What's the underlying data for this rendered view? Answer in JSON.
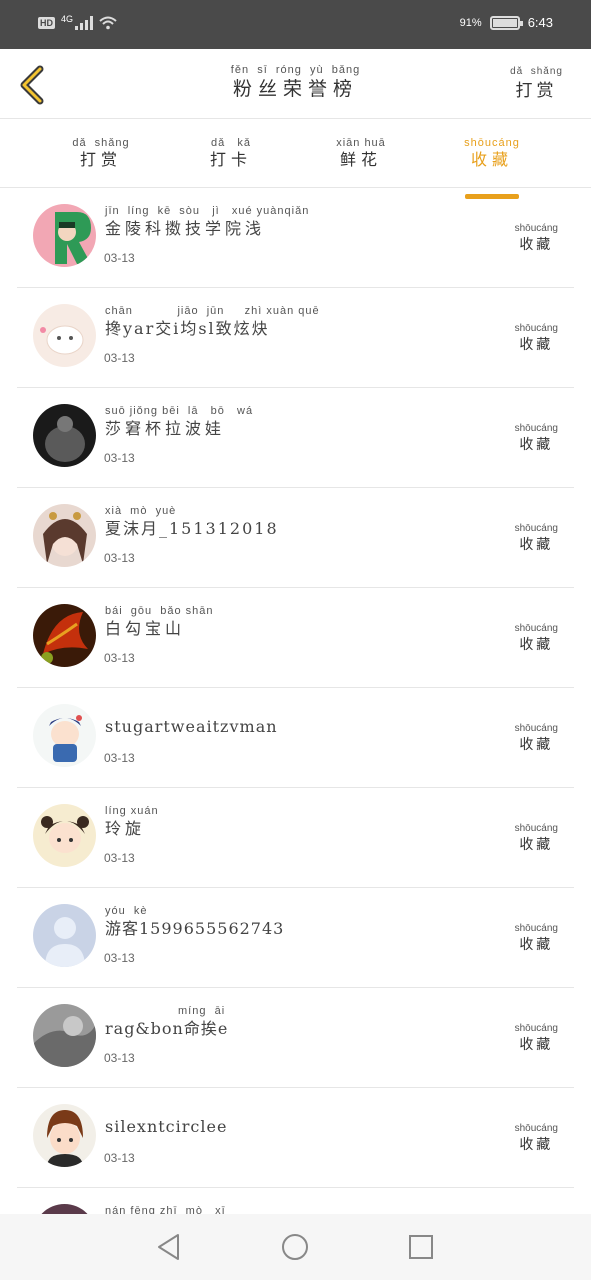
{
  "status": {
    "battery": "91%",
    "time": "6:43",
    "network_label": "HD",
    "network_gen": "4G",
    "battery_level": 0.91
  },
  "header": {
    "title_pinyin": "fěn  sī  róng  yù  bǎng",
    "title": "粉丝荣誉榜",
    "reward_pinyin": "dǎ  shǎng",
    "reward": "打赏"
  },
  "tabs": [
    {
      "pinyin": "dǎ  shǎng",
      "label": "打赏"
    },
    {
      "pinyin": "dǎ   kǎ",
      "label": "打卡"
    },
    {
      "pinyin": "xiān huā",
      "label": "鲜花"
    },
    {
      "pinyin": "shōucáng",
      "label": "收藏"
    }
  ],
  "active_tab_index": 3,
  "fav_label": {
    "pinyin": "shōucáng",
    "label": "收藏"
  },
  "rows": [
    {
      "pinyin": "jīn  líng  kē  sòu   jì   xué yuànqiǎn",
      "name": "金陵科擞技学院浅",
      "date": "03-13"
    },
    {
      "pinyin": "chān           jiāo  jūn     zhì xuàn quē",
      "name": "搀yar交i均sl致炫炔",
      "date": "03-13"
    },
    {
      "pinyin": "suō jiǒng bēi  lā   bō   wá",
      "name": "莎窘杯拉波娃",
      "date": "03-13"
    },
    {
      "pinyin": "xià  mò  yuè",
      "name": "夏沫月_151312018",
      "date": "03-13"
    },
    {
      "pinyin": "bái  gōu  bǎo shān",
      "name": "白勾宝山",
      "date": "03-13"
    },
    {
      "pinyin": "",
      "name": "stugartweaitzvman",
      "date": "03-13"
    },
    {
      "pinyin": "líng xuán",
      "name": "玲旋",
      "date": "03-13"
    },
    {
      "pinyin": "yóu  kè",
      "name": "游客1599655562743",
      "date": "03-13"
    },
    {
      "pinyin": "                  míng  āi",
      "name": "rag&bon命挨e",
      "date": "03-13"
    },
    {
      "pinyin": "",
      "name": "silexntcirclee",
      "date": "03-13"
    },
    {
      "pinyin": "nán fēng zhī  mò   xī",
      "name": "",
      "date": ""
    }
  ]
}
